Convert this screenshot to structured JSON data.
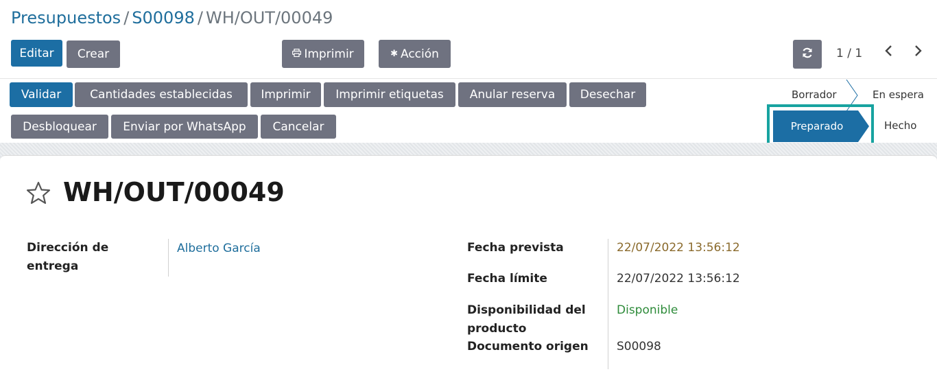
{
  "breadcrumb": {
    "items": [
      "Presupuestos",
      "S00098"
    ],
    "separator": "/",
    "current": "WH/OUT/00049"
  },
  "control_panel": {
    "edit_label": "Editar",
    "create_label": "Crear",
    "print_label": "Imprimir",
    "action_label": "Acción",
    "print_icon": "printer-icon",
    "action_icon": "gear-icon",
    "refresh_icon": "refresh-icon",
    "pager": "1 / 1"
  },
  "header_buttons": {
    "validate": "Validar",
    "set_quantities": "Cantidades establecidas",
    "print": "Imprimir",
    "print_labels": "Imprimir etiquetas",
    "unreserve": "Anular reserva",
    "scrap": "Desechar",
    "unlock": "Desbloquear",
    "whatsapp": "Enviar por WhatsApp",
    "cancel": "Cancelar"
  },
  "status": {
    "draft": "Borrador",
    "waiting": "En espera",
    "assigned": "Preparado",
    "done": "Hecho",
    "active": "Preparado"
  },
  "record": {
    "title": "WH/OUT/00049",
    "delivery_address_label": "Dirección de entrega",
    "delivery_address_value": "Alberto García",
    "scheduled_date_label": "Fecha prevista",
    "scheduled_date_value": "22/07/2022 13:56:12",
    "deadline_label": "Fecha límite",
    "deadline_value": "22/07/2022 13:56:12",
    "availability_label": "Disponibilidad del producto",
    "availability_value": "Disponible",
    "origin_label": "Documento origen",
    "origin_value": "S00098"
  },
  "colors": {
    "primary": "#1c6ea4",
    "secondary": "#6f7280",
    "link": "#1f6e9c",
    "scheduled_date": "#8a6a2c",
    "available": "#2e8b3a",
    "highlight": "#17a3a0"
  }
}
